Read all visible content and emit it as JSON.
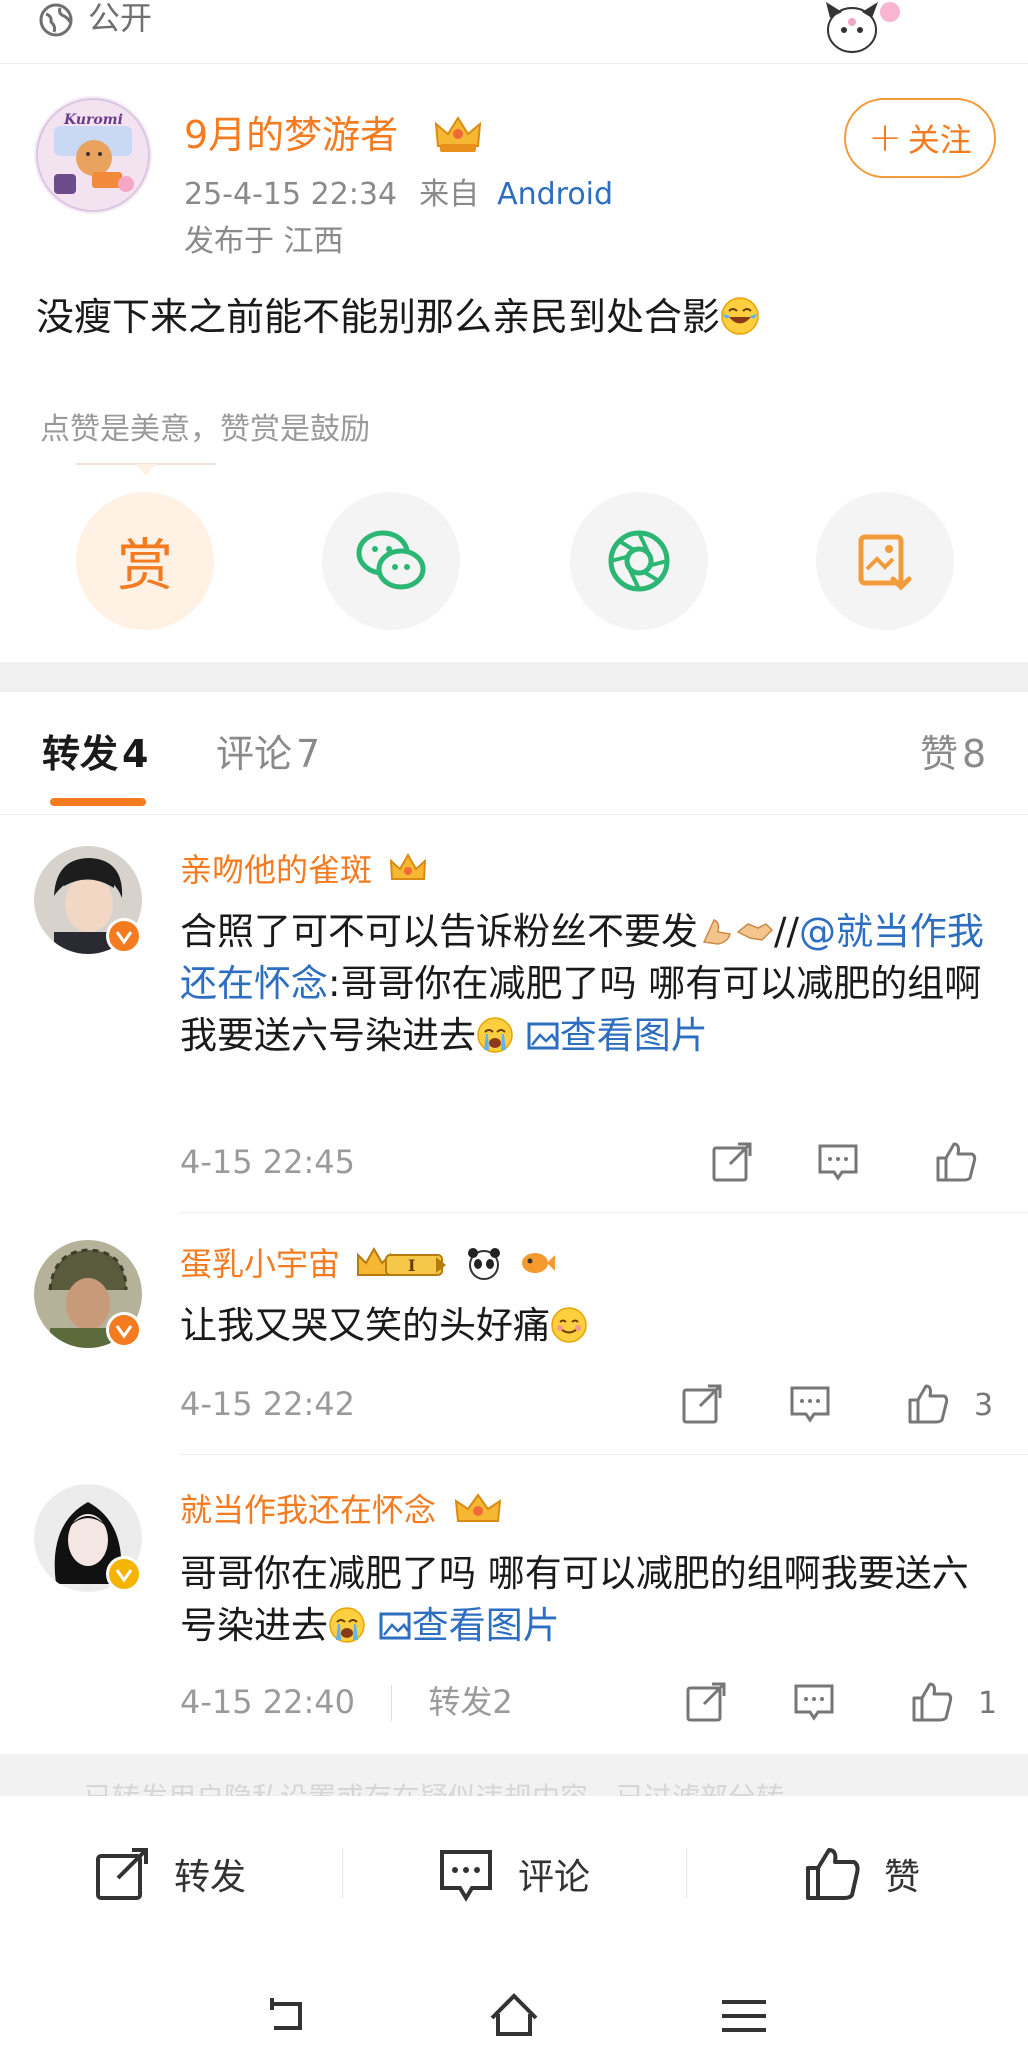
{
  "top": {
    "visibility": "公开",
    "icons": {
      "globe": "globe-icon",
      "mascot": "kuromi-mascot"
    }
  },
  "post": {
    "username": "9月的梦游者",
    "timestamp": "25-4-15 22:34",
    "from_label": "来自",
    "source": "Android",
    "location": "发布于 江西",
    "follow_label": "关注",
    "avatar_text": "Kuromi",
    "text": "没瘦下来之前能不能别那么亲民到处合影",
    "reward_tip": "点赞是美意，赞赏是鼓励",
    "reward_label": "赏"
  },
  "tabs": {
    "repost": "转发",
    "repost_count": "4",
    "comment": "评论",
    "comment_count": "7",
    "like": "赞",
    "like_count": "8"
  },
  "reposts": [
    {
      "name": "亲吻他的雀斑",
      "text_a": "合照了可不可以告诉粉丝不要发",
      "text_b": "//",
      "mention": "@就当作我还在怀念",
      "text_c": ":哥哥你在减肥了吗 哪有可以减肥的组啊我要送六号染进去",
      "image_link": "查看图片",
      "time": "4-15 22:45",
      "like_count": ""
    },
    {
      "name": "蛋乳小宇宙",
      "level_badge": "I",
      "text_a": "让我又哭又笑的头好痛",
      "time": "4-15 22:42",
      "like_count": "3"
    },
    {
      "name": "就当作我还在怀念",
      "text_a": "哥哥你在减肥了吗 哪有可以减肥的组啊我要送六号染进去",
      "image_link": "查看图片",
      "time": "4-15 22:40",
      "repost_label": "转发2",
      "like_count": "1"
    }
  ],
  "footer_faint": "已转发用户隐私设置或存在疑似违规内容，已过滤部分转",
  "bottom_bar": {
    "repost": "转发",
    "comment": "评论",
    "like": "赞"
  },
  "colors": {
    "accent": "#f47b20",
    "link": "#2d6ec1",
    "muted": "#9a9a9a",
    "verified_orange": "#f47b20",
    "verified_yellow": "#f5b400"
  }
}
